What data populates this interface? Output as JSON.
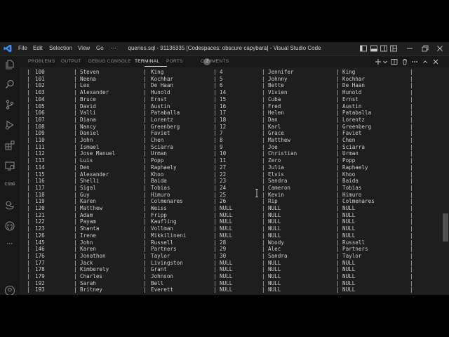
{
  "titlebar": {
    "menu": [
      "File",
      "Edit",
      "Selection",
      "View",
      "Go",
      "···"
    ],
    "window_title": "queries.sql - 91136335 [Codespaces: obscure capybara] - Visual Studio Code"
  },
  "activity_bar": {
    "items": [
      "explorer-icon",
      "search-icon",
      "source-control-icon",
      "run-debug-icon",
      "extensions-icon",
      "remote-explorer-icon"
    ],
    "cs50_label": "CS50",
    "more_label": "···"
  },
  "panel": {
    "tabs": [
      "PROBLEMS",
      "OUTPUT",
      "DEBUG CONSOLE",
      "TERMINAL",
      "PORTS",
      "COMMENTS"
    ],
    "active_tab": "TERMINAL",
    "ports_badge": "2"
  },
  "terminal": {
    "rows": [
      [
        "100",
        "Steven",
        "King",
        "4",
        "Jennifer",
        "King"
      ],
      [
        "101",
        "Neena",
        "Kochhar",
        "5",
        "Johnny",
        "Kochhar"
      ],
      [
        "102",
        "Lex",
        "De Haan",
        "6",
        "Bette",
        "De Haan"
      ],
      [
        "103",
        "Alexander",
        "Hunold",
        "14",
        "Vivien",
        "Hunold"
      ],
      [
        "104",
        "Bruce",
        "Ernst",
        "15",
        "Cuba",
        "Ernst"
      ],
      [
        "105",
        "David",
        "Austin",
        "16",
        "Fred",
        "Austin"
      ],
      [
        "106",
        "Valli",
        "Pataballa",
        "17",
        "Helen",
        "Pataballa"
      ],
      [
        "107",
        "Diana",
        "Lorentz",
        "18",
        "Dan",
        "Lorentz"
      ],
      [
        "108",
        "Nancy",
        "Greenberg",
        "12",
        "Karl",
        "Greenberg"
      ],
      [
        "109",
        "Daniel",
        "Faviet",
        "7",
        "Grace",
        "Faviet"
      ],
      [
        "110",
        "John",
        "Chen",
        "8",
        "Matthew",
        "Chen"
      ],
      [
        "111",
        "Ismael",
        "Sciarra",
        "9",
        "Joe",
        "Sciarra"
      ],
      [
        "112",
        "Jose Manuel",
        "Urman",
        "10",
        "Christian",
        "Urman"
      ],
      [
        "113",
        "Luis",
        "Popp",
        "11",
        "Zero",
        "Popp"
      ],
      [
        "114",
        "Den",
        "Raphaely",
        "27",
        "Julia",
        "Raphaely"
      ],
      [
        "115",
        "Alexander",
        "Khoo",
        "22",
        "Elvis",
        "Khoo"
      ],
      [
        "116",
        "Shelli",
        "Baida",
        "23",
        "Sandra",
        "Baida"
      ],
      [
        "117",
        "Sigal",
        "Tobias",
        "24",
        "Cameron",
        "Tobias"
      ],
      [
        "118",
        "Guy",
        "Himuro",
        "25",
        "Kevin",
        "Himuro"
      ],
      [
        "119",
        "Karen",
        "Colmenares",
        "26",
        "Rip",
        "Colmenares"
      ],
      [
        "120",
        "Matthew",
        "Weiss",
        "NULL",
        "NULL",
        "NULL"
      ],
      [
        "121",
        "Adam",
        "Fripp",
        "NULL",
        "NULL",
        "NULL"
      ],
      [
        "122",
        "Payam",
        "Kaufling",
        "NULL",
        "NULL",
        "NULL"
      ],
      [
        "123",
        "Shanta",
        "Vollman",
        "NULL",
        "NULL",
        "NULL"
      ],
      [
        "126",
        "Irene",
        "Mikkilineni",
        "NULL",
        "NULL",
        "NULL"
      ],
      [
        "145",
        "John",
        "Russell",
        "28",
        "Woody",
        "Russell"
      ],
      [
        "146",
        "Karen",
        "Partners",
        "29",
        "Alec",
        "Partners"
      ],
      [
        "176",
        "Jonathon",
        "Taylor",
        "30",
        "Sandra",
        "Taylor"
      ],
      [
        "177",
        "Jack",
        "Livingston",
        "NULL",
        "NULL",
        "NULL"
      ],
      [
        "178",
        "Kimberely",
        "Grant",
        "NULL",
        "NULL",
        "NULL"
      ],
      [
        "179",
        "Charles",
        "Johnson",
        "NULL",
        "NULL",
        "NULL"
      ],
      [
        "192",
        "Sarah",
        "Bell",
        "NULL",
        "NULL",
        "NULL"
      ],
      [
        "193",
        "Britney",
        "Everett",
        "NULL",
        "NULL",
        "NULL"
      ]
    ]
  },
  "colors": {
    "editor_bg": "#1e1e1e",
    "chrome_bg": "#181818",
    "text": "#cccccc",
    "accent_blue": "#3794ff"
  }
}
